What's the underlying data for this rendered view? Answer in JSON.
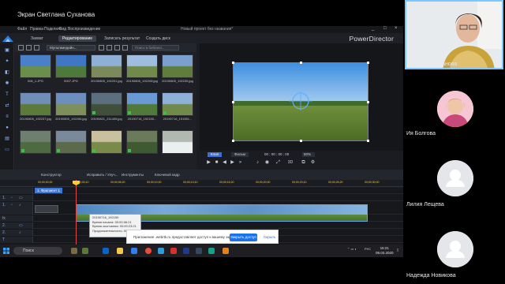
{
  "share": {
    "title": "Экран Светланa Суханова"
  },
  "menubar": {
    "items": [
      "Файл",
      "Правка",
      "Подключ.",
      "Вид",
      "Воспроизведение"
    ],
    "project": "Новый проект без названия*",
    "controls": [
      "_",
      "□",
      "×"
    ]
  },
  "modes": {
    "tabs": [
      "Захват",
      "Редактирование",
      "Записать результат",
      "Создать диск"
    ],
    "active_index": 1,
    "brand": "PowerDirector"
  },
  "library": {
    "dropdown": "Мультимедийн...",
    "search_placeholder": "Поиск в библиот...",
    "items": [
      {
        "caption": "006_1.JPG",
        "badge": false
      },
      {
        "caption": "0007.JPG",
        "badge": false
      },
      {
        "caption": "20190805_192201.jpg",
        "badge": false
      },
      {
        "caption": "20190805_192208.jpg",
        "badge": false
      },
      {
        "caption": "20190805_192235.jpg",
        "badge": false
      },
      {
        "caption": "20190805_192237.jpg",
        "badge": false
      },
      {
        "caption": "20190805_192256.jpg",
        "badge": false
      },
      {
        "caption": "20190821_211405.jpg",
        "badge": true
      },
      {
        "caption": "20190716_192150...",
        "badge": true
      },
      {
        "caption": "20190716_191551...",
        "badge": true
      },
      {
        "caption": "",
        "badge": true
      },
      {
        "caption": "",
        "badge": true
      },
      {
        "caption": "",
        "badge": true
      },
      {
        "caption": "",
        "badge": true
      },
      {
        "caption": "",
        "badge": false
      }
    ]
  },
  "preview": {
    "tabs": [
      "Клип",
      "Фильм"
    ],
    "active_tab": 0,
    "timecode": "00 ; 00 ; 00 ; 00",
    "zoom": "50%",
    "mode": "3D"
  },
  "timeline_toolbar": {
    "tools": [
      "Конструктор",
      "Исправить / Улуч...",
      "Инструменты",
      "Ключевой кадр"
    ]
  },
  "ruler": {
    "ticks": [
      "00;00;00;00",
      "00;00;03;10",
      "00;00;06;20",
      "00;00;10;00",
      "00;00;13;10",
      "00;00;16;20",
      "00;00;20;00",
      "00;00;23;10",
      "00;00;26;20",
      "00;00;30;00",
      "00;00;33;10"
    ]
  },
  "tracks": {
    "marker_label": "1. Фрагмент 1",
    "rows": [
      "1.",
      "1.",
      "",
      "fx",
      "2.",
      "2.",
      "T",
      "",
      "",
      ""
    ]
  },
  "clip_tooltip": {
    "lines": [
      "20190716_192150",
      "Время начала: 00:00:06:21",
      "Время окончания: 00:00:23:21",
      "Продолжительность: 00:00:48:01"
    ]
  },
  "notification": {
    "text": "Приложение .webrtk.ru предоставляет доступ к вашему экрану.",
    "primary": "Закрыть доступ",
    "secondary": "Скрыть"
  },
  "taskbar": {
    "search": "Поиск",
    "tray_lang": "РУС",
    "time": "15:21",
    "date": "09.03.2020"
  },
  "participants": [
    {
      "name": "Светлана Суханова",
      "type": "camera"
    },
    {
      "name": "Ия Болгова",
      "type": "photo"
    },
    {
      "name": "Лилия Лещева",
      "type": "placeholder"
    },
    {
      "name": "Надежда Новикова",
      "type": "placeholder"
    }
  ]
}
